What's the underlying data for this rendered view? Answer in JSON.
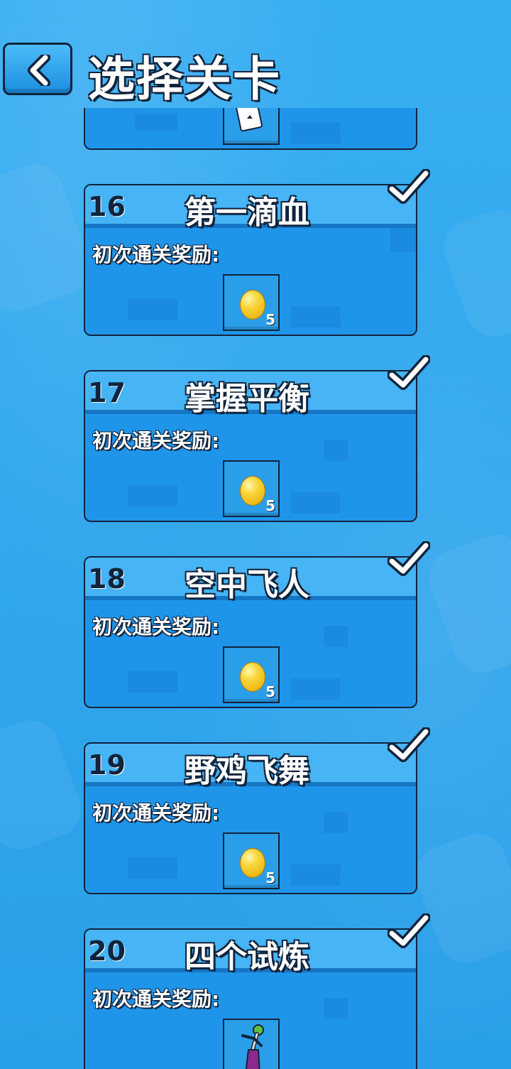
{
  "header": {
    "title": "选择关卡",
    "back_icon": "chevron-left-icon"
  },
  "reward_label": "初次通关奖励:",
  "levels": [
    {
      "number": "16",
      "name": "第一滴血",
      "reward": {
        "type": "coin",
        "count": "5"
      },
      "completed": true
    },
    {
      "number": "17",
      "name": "掌握平衡",
      "reward": {
        "type": "coin",
        "count": "5"
      },
      "completed": true
    },
    {
      "number": "18",
      "name": "空中飞人",
      "reward": {
        "type": "coin",
        "count": "5"
      },
      "completed": true
    },
    {
      "number": "19",
      "name": "野鸡飞舞",
      "reward": {
        "type": "coin",
        "count": "5"
      },
      "completed": true
    },
    {
      "number": "20",
      "name": "四个试炼",
      "reward": {
        "type": "character-skin"
      },
      "completed": true
    }
  ],
  "colors": {
    "background": "#2aa3ec",
    "card": "#1f95ea",
    "card_header": "#46b4f5",
    "outline": "#10243d"
  }
}
